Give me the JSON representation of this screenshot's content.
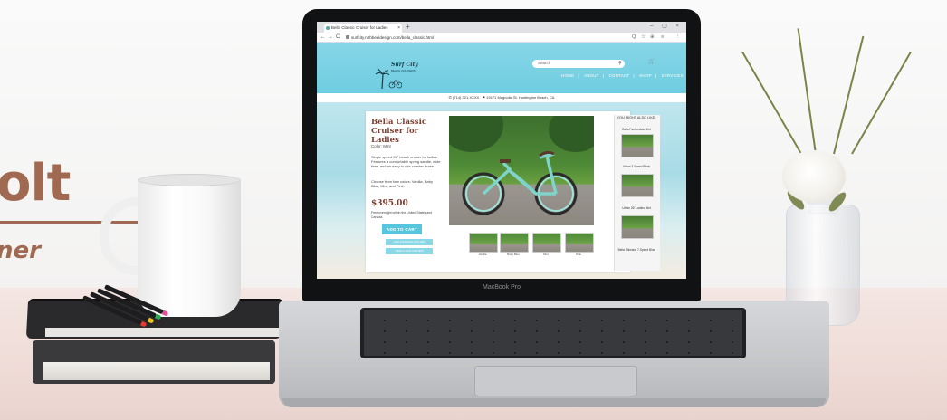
{
  "scene": {
    "brand_title": "olt",
    "brand_subtitle": "ner",
    "laptop_label": "MacBook Pro"
  },
  "browser": {
    "tab_title": "Bella Classic Cruiser for Ladies",
    "tab_close": "×",
    "new_tab": "+",
    "window_controls": "– ▢ ×",
    "nav_back": "←",
    "nav_forward": "→",
    "nav_reload": "C",
    "url": "surfcity.ruthbeeldesign.com/bella_classic.html",
    "toolbar_icons": [
      "Q",
      "☆",
      "⊕",
      "≡",
      "⋮"
    ]
  },
  "site": {
    "logo_text": "Surf City",
    "logo_sub": "BEACH CRUISERS",
    "search_placeholder": "Search",
    "search_icon": "search-icon",
    "cart_icon": "cart-icon",
    "menu": [
      "HOME",
      "ABOUT",
      "CONTACT",
      "SHOP",
      "SERVICES"
    ],
    "menu_separator": "|",
    "phone": "(714) 321-XXXX",
    "address": "19171 Magnolia St. Huntington Beach, CA"
  },
  "product": {
    "title": "Bella Classic Cruiser for Ladies",
    "color": "Color: Mint",
    "description": "Single speed 26\" beach cruiser for ladies. Features a comfortable spring saddle, wide tires, and an easy to use coaster brake.",
    "choose": "Choose from four colors: Vanilla, Baby Blue, Mint, and Pink.",
    "price": "$395.00",
    "note": "Free overnight within the United States and Canada.",
    "add_to_cart": "ADD TO CART",
    "add_basket": "ADD A BASKET FOR $25",
    "add_lock": "ADD A LOCK FOR $25",
    "thumbnails": [
      "Vanilla",
      "Baby Blue",
      "Mint",
      "Pink"
    ]
  },
  "sidebar": {
    "heading": "YOU MIGHT ALSO LIKE:",
    "items": [
      "Bella Fashionista Mint",
      "Urban 3-Speed Black",
      "Urban 26\" Ladies Mint",
      "Bella Shimano 7-Speed Blue"
    ]
  },
  "colors": {
    "header": "#6fcde1",
    "accent": "#56c6de",
    "title": "#7a3d2d",
    "brand": "#a06a52"
  }
}
